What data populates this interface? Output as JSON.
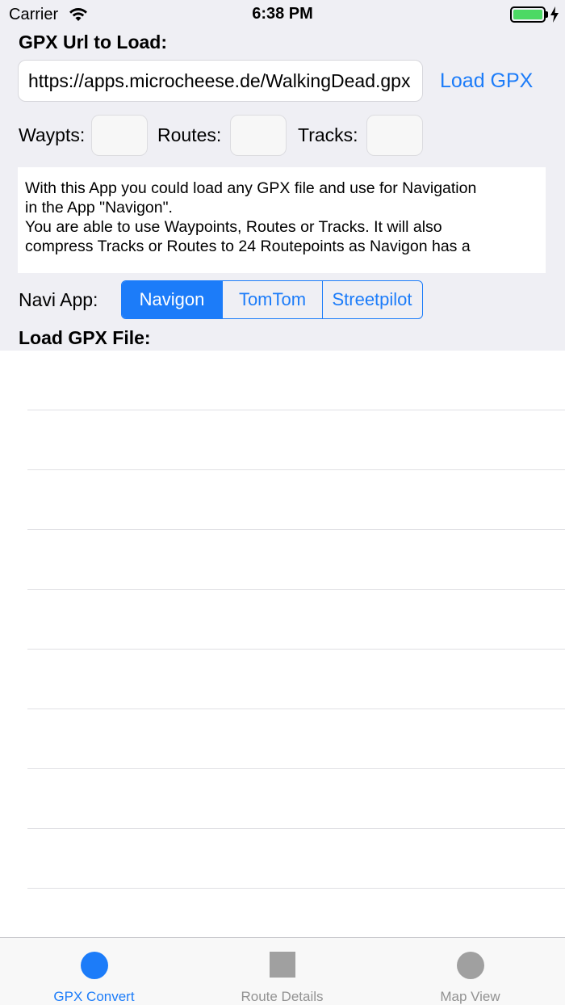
{
  "status_bar": {
    "carrier": "Carrier",
    "time": "6:38 PM"
  },
  "form": {
    "url_heading": "GPX Url to Load:",
    "url_value": "https://apps.microcheese.de/WalkingDead.gpx",
    "load_button": "Load GPX",
    "waypoints_label": "Waypts:",
    "routes_label": "Routes:",
    "tracks_label": "Tracks:",
    "description_lines": [
      "With this App you could load any GPX file and use for Navigation",
      "in the App \"Navigon\".",
      "You are able to use Waypoints, Routes or Tracks. It will also",
      "compress Tracks or Routes to 24 Routepoints as Navigon has a"
    ],
    "navi_label": "Navi App:",
    "navi_options": [
      "Navigon",
      "TomTom",
      "Streetpilot"
    ],
    "navi_selected": "Navigon",
    "file_heading": "Load GPX File:"
  },
  "file_list_rows": 10,
  "tab_bar": {
    "tabs": [
      {
        "label": "GPX Convert",
        "icon": "circle-icon",
        "active": true
      },
      {
        "label": "Route Details",
        "icon": "square-icon",
        "active": false
      },
      {
        "label": "Map View",
        "icon": "circle-icon",
        "active": false
      }
    ]
  },
  "colors": {
    "accent": "#1c7cf9",
    "battery": "#4cd964",
    "background": "#efeff4"
  }
}
